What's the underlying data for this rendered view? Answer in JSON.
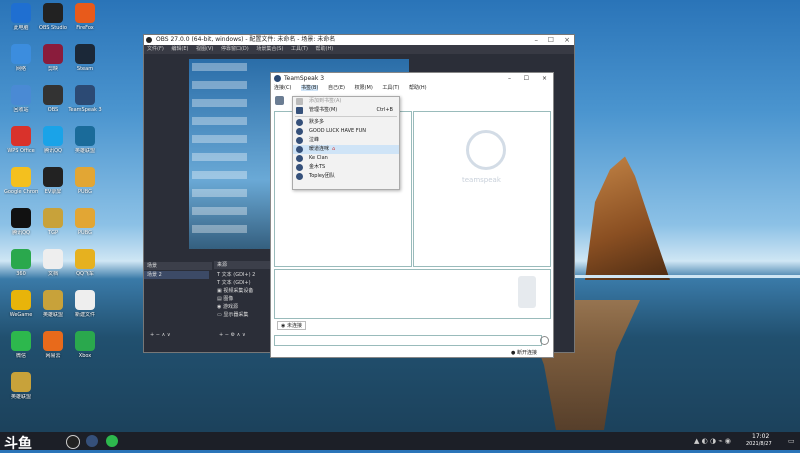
{
  "desktop": {
    "icons": [
      {
        "label": "此电脑"
      },
      {
        "label": "OBS Studio"
      },
      {
        "label": "FireFox"
      },
      {
        "label": "网络"
      },
      {
        "label": "剪映"
      },
      {
        "label": "Steam"
      },
      {
        "label": "回收站"
      },
      {
        "label": "OBS"
      },
      {
        "label": "TeamSpeak 3"
      },
      {
        "label": "WPS Office"
      },
      {
        "label": "腾讯QQ"
      },
      {
        "label": "英雄联盟"
      },
      {
        "label": "Google Chrome"
      },
      {
        "label": "EV录屏"
      },
      {
        "label": "PUBG"
      },
      {
        "label": "腾讯QQ"
      },
      {
        "label": "TGP"
      },
      {
        "label": "PUBG"
      },
      {
        "label": "360"
      },
      {
        "label": "文档"
      },
      {
        "label": "QQ飞车"
      },
      {
        "label": "WeGame"
      },
      {
        "label": "英雄联盟"
      },
      {
        "label": "新建文件"
      },
      {
        "label": "微信"
      },
      {
        "label": "网易云"
      },
      {
        "label": "Xbox"
      },
      {
        "label": "英雄联盟"
      }
    ]
  },
  "obs": {
    "title": "OBS 27.0.0 (64-bit, windows) - 配置文件: 未命名 - 场景: 未命名",
    "menu": [
      "文件(F)",
      "编辑(E)",
      "视图(V)",
      "停靠窗口(D)",
      "场景集合(S)",
      "工具(T)",
      "帮助(H)"
    ],
    "scenes_header": "来源",
    "scenes_label": "场景",
    "scene_item": "场景 2",
    "sources": [
      "文本 (GDI+) 2",
      "文本 (GDI+)",
      "视频采集设备",
      "图像",
      "游戏源",
      "显示器采集"
    ]
  },
  "teamspeak": {
    "title": "TeamSpeak 3",
    "menu": [
      "连接(C)",
      "书签(B)",
      "自己(E)",
      "权限(M)",
      "工具(T)",
      "帮助(H)"
    ],
    "dropdown": {
      "items": [
        {
          "label": "添加到书签(A)",
          "shortcut": "",
          "disabled": true
        },
        {
          "label": "管理书签(M)",
          "shortcut": "Ctrl+B",
          "disabled": false
        },
        {
          "label": "默多多",
          "shortcut": "",
          "disabled": false
        },
        {
          "label": "GOOD LUCK HAVE FUN",
          "shortcut": "",
          "disabled": false
        },
        {
          "label": "泣峰",
          "shortcut": "",
          "disabled": false
        },
        {
          "label": "暖道连咪",
          "shortcut": "",
          "disabled": false,
          "selected": true
        },
        {
          "label": "Ke Clan",
          "shortcut": "",
          "disabled": false
        },
        {
          "label": "金木TS",
          "shortcut": "",
          "disabled": false
        },
        {
          "label": "Topley团队",
          "shortcut": "",
          "disabled": false
        }
      ]
    },
    "logo_text": "teamspeak",
    "tab_label": "未连接",
    "status": "断开连接"
  },
  "taskbar": {
    "brand": "斗鱼",
    "time": "17:02",
    "date": "2021/8/27"
  }
}
